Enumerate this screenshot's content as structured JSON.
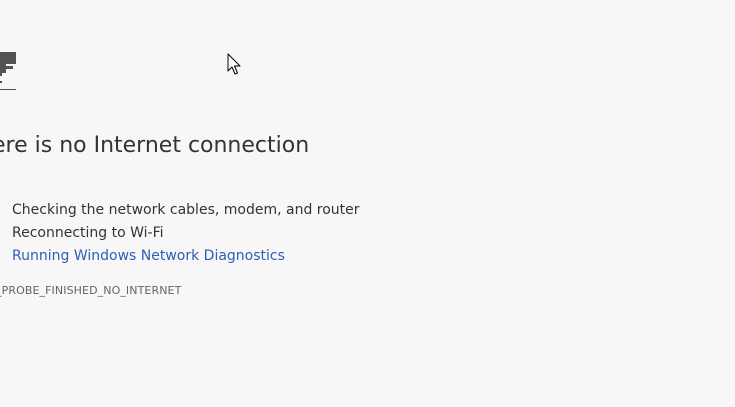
{
  "headline": "ere is no Internet connection",
  "suggestions": {
    "items": [
      "Checking the network cables, modem, and router",
      "Reconnecting to Wi-Fi"
    ],
    "diagnostics_link": "Running Windows Network Diagnostics"
  },
  "error_code": "_PROBE_FINISHED_NO_INTERNET",
  "icons": {
    "dino": "offline-dino-icon",
    "cursor": "mouse-pointer-icon"
  },
  "colors": {
    "background": "#f7f7f7",
    "text": "#333333",
    "link": "#2e5eb8",
    "error_code": "#646464"
  }
}
